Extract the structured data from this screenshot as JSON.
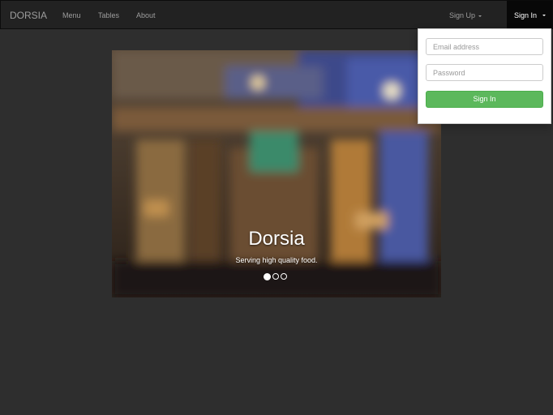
{
  "navbar": {
    "brand": "DORSIA",
    "links": [
      "Menu",
      "Tables",
      "About"
    ],
    "sign_up": "Sign Up",
    "sign_in": "Sign In"
  },
  "carousel": {
    "title": "Dorsia",
    "caption": "Serving high quality food.",
    "slide_count": 3,
    "active_slide": 1
  },
  "signin_form": {
    "email_placeholder": "Email address",
    "password_placeholder": "Password",
    "submit_label": "Sign In"
  },
  "colors": {
    "background": "#2e2e2e",
    "navbar": "#222222",
    "signin_button": "#5cb85c"
  }
}
